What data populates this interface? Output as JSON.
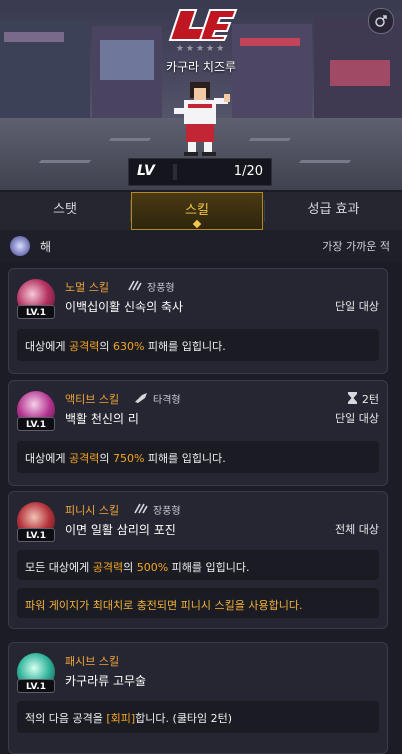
{
  "hero": {
    "character_name": "카구라 치즈루",
    "stars": "★★★★★",
    "level_label": "LV",
    "level_value": "1/20",
    "logo_text": "LE"
  },
  "tabs": [
    {
      "label": "스탯",
      "active": false
    },
    {
      "label": "스킬",
      "active": true
    },
    {
      "label": "성급 효과",
      "active": false
    }
  ],
  "filter": {
    "element_label": "해",
    "target_rule": "가장 가까운 적"
  },
  "skills": [
    {
      "level": "LV.1",
      "type": "노멀 스킬",
      "range": "장풍형",
      "name": "이백십이활 신속의 축사",
      "target": "단일 대상",
      "desc_pre": "대상에게 ",
      "desc_stat": "공격력",
      "desc_mid": "의 ",
      "desc_pct": "630%",
      "desc_post": " 피해를 입힙니다."
    },
    {
      "level": "LV.1",
      "type": "액티브 스킬",
      "range": "타격형",
      "cooldown": "2턴",
      "name": "백활 천신의 리",
      "target": "단일 대상",
      "desc_pre": "대상에게 ",
      "desc_stat": "공격력",
      "desc_mid": "의 ",
      "desc_pct": "750%",
      "desc_post": " 피해를 입힙니다."
    },
    {
      "level": "LV.1",
      "type": "피니시 스킬",
      "range": "장풍형",
      "name": "이면 일활 삼리의 포진",
      "target": "전체 대상",
      "desc_pre": "모든 대상에게 ",
      "desc_stat": "공격력",
      "desc_mid": "의 ",
      "desc_pct": "500%",
      "desc_post": " 피해를 입힙니다.",
      "note": "파워 게이지가 최대치로 충전되면 피니시 스킬을 사용합니다."
    },
    {
      "level": "LV.1",
      "type": "패시브 스킬",
      "name": "카구라류 고무술",
      "desc_pre": "적의 다음 공격을 ",
      "desc_key": "[회피]",
      "desc_post": "합니다. (쿨타임 2턴)"
    }
  ],
  "colors": {
    "accent_gold": "#f5c64a",
    "skill_type_orange": "#f0a53a",
    "highlight_orange": "#f5a623",
    "card_bg": "#252631",
    "page_bg": "#1b1c25"
  }
}
